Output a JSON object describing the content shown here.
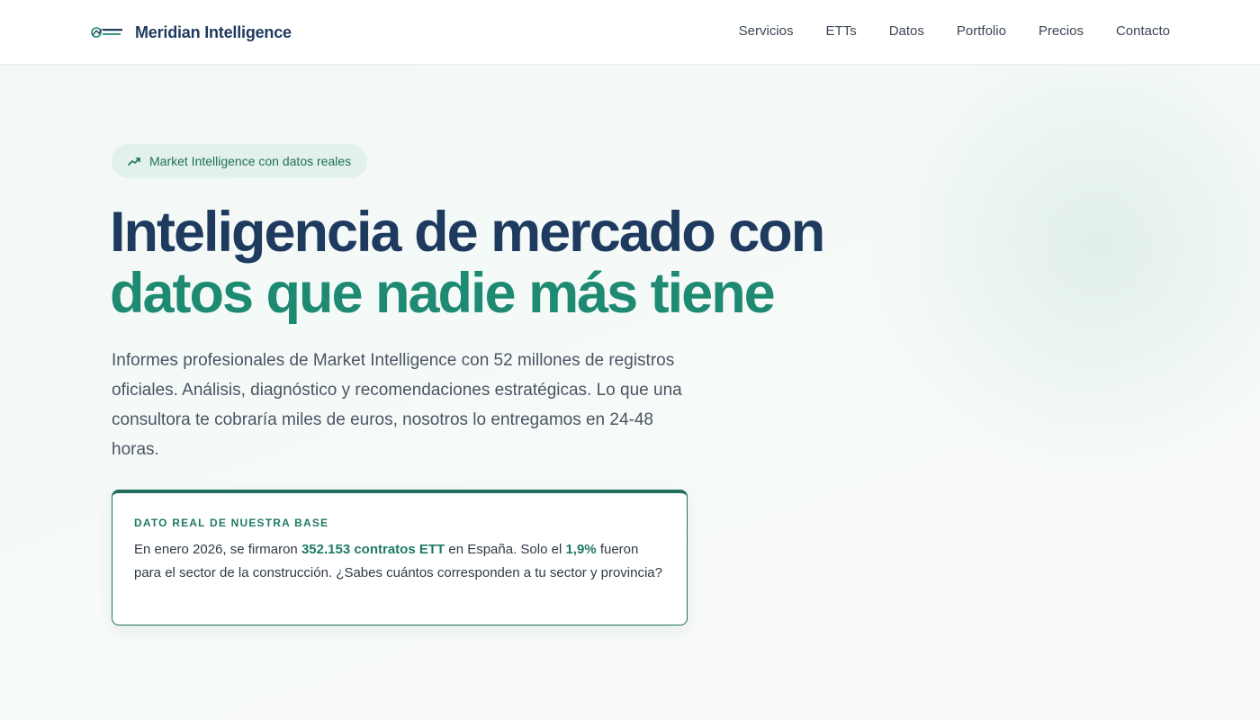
{
  "header": {
    "brand_name": "Meridian Intelligence",
    "logo_text_top": "Meridian",
    "logo_text_bottom": "Intelligence",
    "nav": [
      "Servicios",
      "ETTs",
      "Datos",
      "Portfolio",
      "Precios",
      "Contacto"
    ]
  },
  "hero": {
    "badge_icon": "trending-up-icon",
    "badge_text": "Market Intelligence con datos reales",
    "headline_line1": "Inteligencia de mercado con",
    "headline_line2": "datos que nadie más tiene",
    "lead": "Informes profesionales de Market Intelligence con 52 millones de registros oficiales. Análisis, diagnóstico y recomendaciones estratégicas. Lo que una consultora te cobraría miles de euros, nosotros lo entregamos en 24-48 horas."
  },
  "fact_card": {
    "label": "DATO REAL DE NUESTRA BASE",
    "text_part1": "En enero 2026, se firmaron ",
    "highlight1": "352.153 contratos ETT",
    "text_part2": " en España. Solo el ",
    "highlight2": "1,9%",
    "text_part3": " fueron para el sector de la construcción. ¿Sabes cuántos corresponden a tu sector y provincia?"
  },
  "colors": {
    "navy": "#1e3a5f",
    "green": "#1f8a72",
    "green_dark": "#1f6f5c",
    "badge_bg": "#e3f1ec"
  }
}
